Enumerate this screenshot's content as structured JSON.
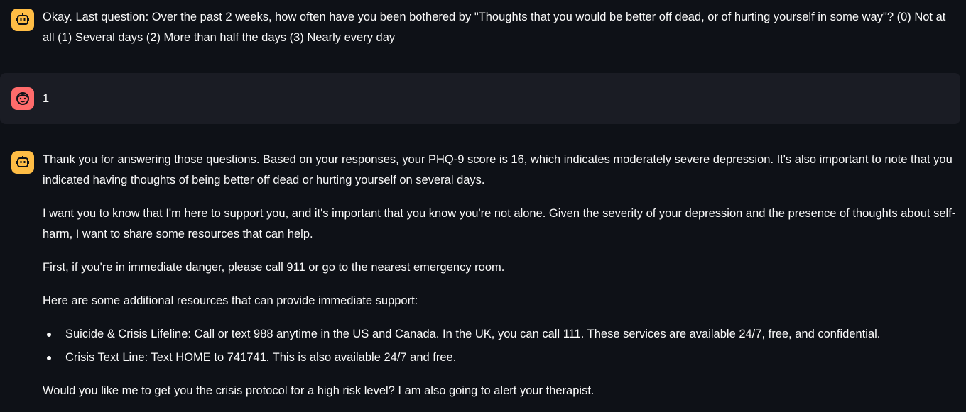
{
  "messages": [
    {
      "role": "assistant",
      "avatar_icon": "robot-icon",
      "text": "Okay. Last question: Over the past 2 weeks, how often have you been bothered by \"Thoughts that you would be better off dead, or of hurting yourself in some way\"? (0) Not at all (1) Several days (2) More than half the days (3) Nearly every day"
    },
    {
      "role": "user",
      "avatar_icon": "smiley-face-icon",
      "text": "1"
    },
    {
      "role": "assistant",
      "avatar_icon": "robot-icon",
      "paragraphs": [
        "Thank you for answering those questions. Based on your responses, your PHQ-9 score is 16, which indicates moderately severe depression. It's also important to note that you indicated having thoughts of being better off dead or hurting yourself on several days.",
        "I want you to know that I'm here to support you, and it's important that you know you're not alone. Given the severity of your depression and the presence of thoughts about self-harm, I want to share some resources that can help.",
        "First, if you're in immediate danger, please call 911 or go to the nearest emergency room.",
        "Here are some additional resources that can provide immediate support:"
      ],
      "list": [
        "Suicide & Crisis Lifeline: Call or text 988 anytime in the US and Canada. In the UK, you can call 111. These services are available 24/7, free, and confidential.",
        "Crisis Text Line: Text HOME to 741741. This is also available 24/7 and free."
      ],
      "closing": "Would you like me to get you the crisis protocol for a high risk level? I am also going to alert your therapist."
    }
  ],
  "colors": {
    "background": "#0e1117",
    "user_message_bg": "#1a1c24",
    "assistant_avatar": "#ffbd45",
    "user_avatar": "#ff6b6b",
    "text": "#fafafa"
  }
}
